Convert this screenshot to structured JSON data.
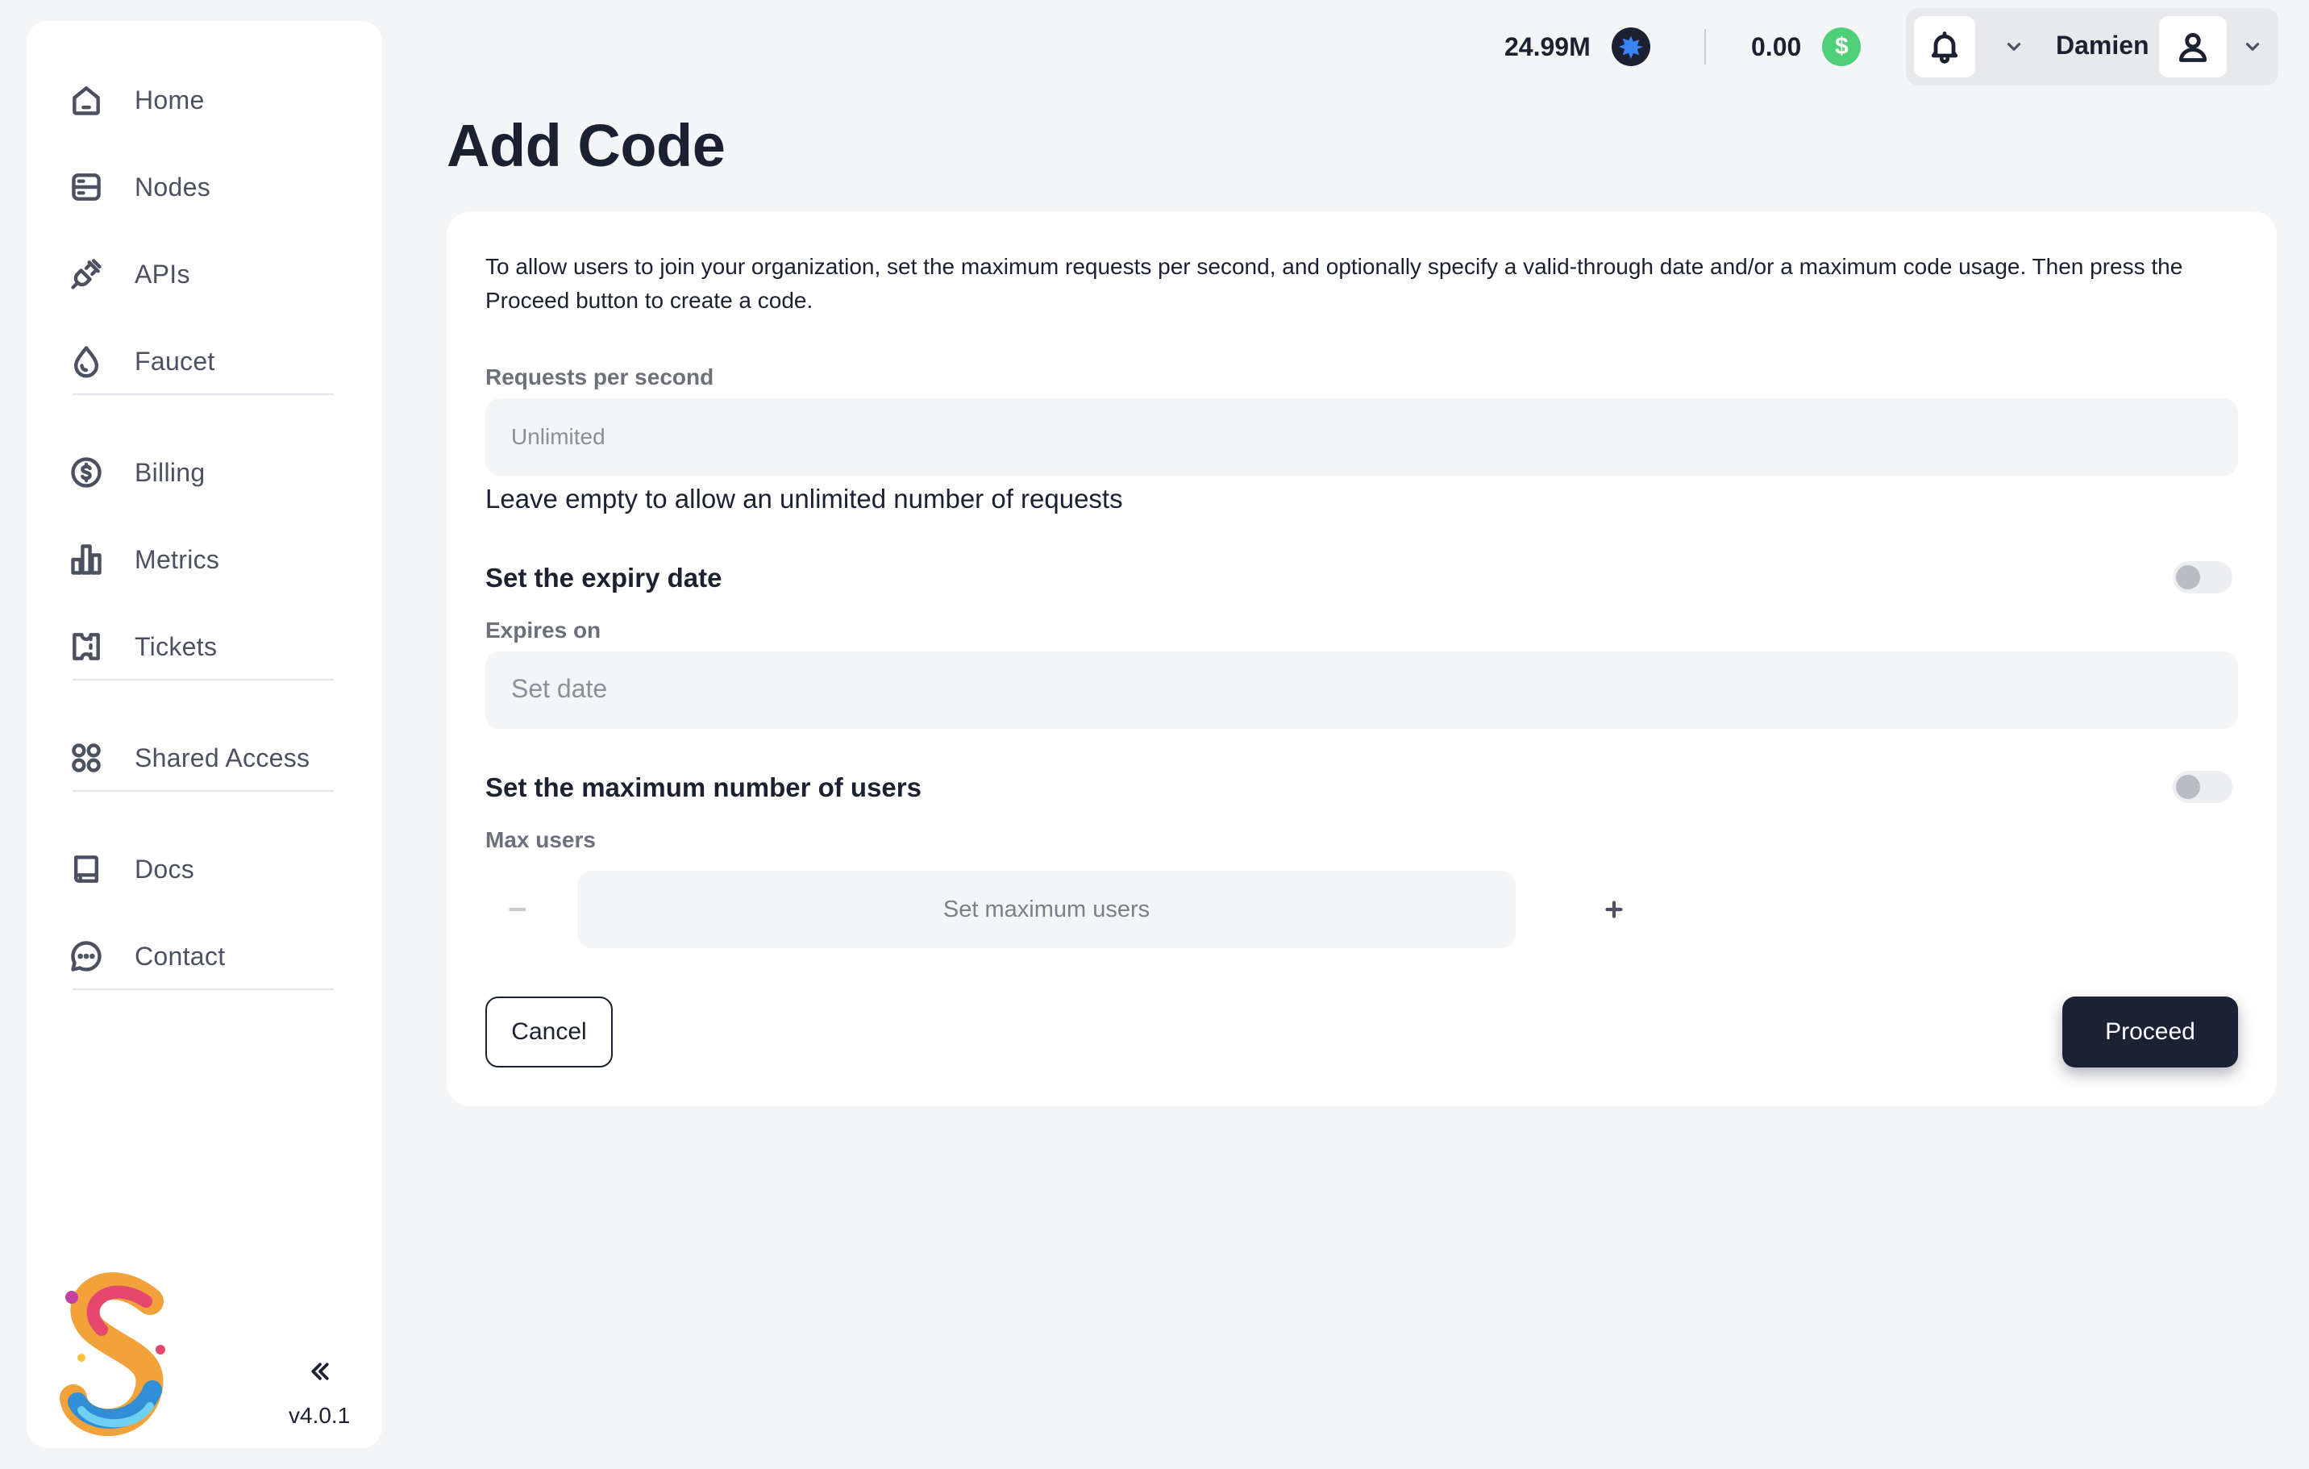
{
  "sidebar": {
    "items": [
      {
        "label": "Home",
        "icon": "home-icon"
      },
      {
        "label": "Nodes",
        "icon": "server-icon"
      },
      {
        "label": "APIs",
        "icon": "plug-icon"
      },
      {
        "label": "Faucet",
        "icon": "drop-icon"
      },
      {
        "label": "Billing",
        "icon": "dollar-circle-icon"
      },
      {
        "label": "Metrics",
        "icon": "bar-chart-icon"
      },
      {
        "label": "Tickets",
        "icon": "ticket-icon"
      },
      {
        "label": "Shared Access",
        "icon": "grid-circles-icon"
      },
      {
        "label": "Docs",
        "icon": "book-icon"
      },
      {
        "label": "Contact",
        "icon": "chat-bubble-icon"
      }
    ],
    "version": "v4.0.1",
    "collapse_icon": "chevrons-left-icon"
  },
  "header": {
    "token_balance": "24.99M",
    "token_icon": "blue-star-coin-icon",
    "usd_balance": "0.00",
    "usd_icon": "green-dollar-coin-icon",
    "user_name": "Damien"
  },
  "main": {
    "title": "Add Code",
    "intro": "To allow users to join your organization, set the maximum requests per second, and optionally specify a valid-through date and/or a maximum code usage. Then press the Proceed button to create a code.",
    "requests": {
      "label": "Requests per second",
      "placeholder": "Unlimited",
      "help": "Leave empty to allow an unlimited number of requests"
    },
    "expiry": {
      "title": "Set the expiry date",
      "label": "Expires on",
      "placeholder": "Set date",
      "enabled": false
    },
    "max_users": {
      "title": "Set the maximum number of users",
      "label": "Max users",
      "placeholder": "Set maximum users",
      "enabled": false
    },
    "cancel_label": "Cancel",
    "proceed_label": "Proceed"
  },
  "colors": {
    "primary": "#1b2235",
    "background": "#f4f5f7",
    "usd_coin": "#4fcf78",
    "token_coin": "#3b82f6"
  }
}
